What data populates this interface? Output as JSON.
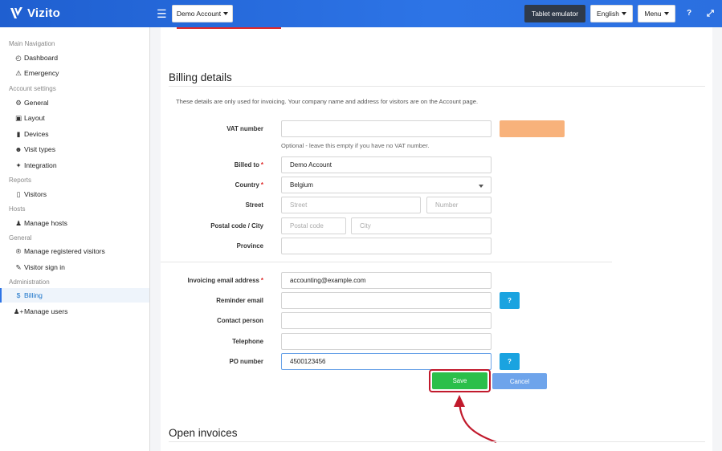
{
  "app": {
    "name": "Vizito"
  },
  "topbar": {
    "account_label": "Demo Account",
    "tablet_label": "Tablet emulator",
    "language_label": "English",
    "menu_label": "Menu",
    "help_icon": "question-icon",
    "fullscreen_icon": "expand-icon"
  },
  "sidebar": {
    "sections": [
      {
        "header": "Main Navigation",
        "items": [
          {
            "label": "Dashboard",
            "icon": "dashboard-gauge-icon"
          },
          {
            "label": "Emergency",
            "icon": "warning-icon"
          }
        ]
      },
      {
        "header": "Account settings",
        "items": [
          {
            "label": "General",
            "icon": "gear-icon"
          },
          {
            "label": "Layout",
            "icon": "image-icon"
          },
          {
            "label": "Devices",
            "icon": "tablet-icon"
          },
          {
            "label": "Visit types",
            "icon": "users-icon"
          },
          {
            "label": "Integration",
            "icon": "plug-icon"
          }
        ]
      },
      {
        "header": "Reports",
        "items": [
          {
            "label": "Visitors",
            "icon": "book-icon"
          }
        ]
      },
      {
        "header": "Hosts",
        "items": [
          {
            "label": "Manage hosts",
            "icon": "user-tie-icon"
          }
        ]
      },
      {
        "header": "General",
        "items": [
          {
            "label": "Manage registered visitors",
            "icon": "registered-icon"
          },
          {
            "label": "Visitor sign in",
            "icon": "pencil-icon"
          }
        ]
      },
      {
        "header": "Administration",
        "items": [
          {
            "label": "Billing",
            "icon": "dollar-icon",
            "active": true
          },
          {
            "label": "Manage users",
            "icon": "user-plus-icon"
          }
        ]
      }
    ]
  },
  "billing": {
    "title": "Billing details",
    "description": "These details are only used for invoicing. Your company name and address for visitors are on the Account page.",
    "vat_label": "VAT number",
    "vat_value": "",
    "vat_hint": "Optional - leave this empty if you have no VAT number.",
    "billed_to_label": "Billed to",
    "billed_to_value": "Demo Account",
    "country_label": "Country",
    "country_value": "Belgium",
    "street_label": "Street",
    "street_placeholder": "Street",
    "number_placeholder": "Number",
    "postal_city_label": "Postal code / City",
    "postal_placeholder": "Postal code",
    "city_placeholder": "City",
    "province_label": "Province",
    "invoice_email_label": "Invoicing email address",
    "invoice_email_value": "accounting@example.com",
    "reminder_email_label": "Reminder email",
    "contact_person_label": "Contact person",
    "telephone_label": "Telephone",
    "po_number_label": "PO number",
    "po_number_value": "4500123456",
    "help_button": "?",
    "required_mark": "*",
    "save_label": "Save",
    "cancel_label": "Cancel"
  },
  "open_invoices": {
    "title": "Open invoices"
  },
  "colors": {
    "topbar": "#2d74e6",
    "save": "#2bbf4a",
    "cancel": "#6ea4eb",
    "help": "#1aa3e0",
    "highlight": "#c11a2c",
    "active_nav": "#1a73c9"
  }
}
